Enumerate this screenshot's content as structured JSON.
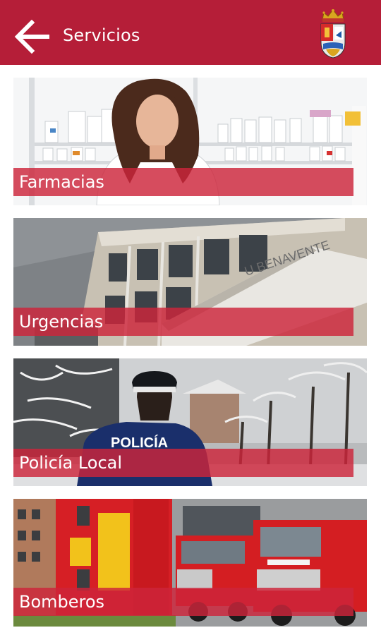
{
  "header": {
    "title": "Servicios",
    "back_icon": "arrow-left-icon",
    "crest_icon": "municipal-coat-of-arms",
    "background_color": "#b51e38"
  },
  "services": [
    {
      "label": "Farmacias"
    },
    {
      "label": "Urgencias"
    },
    {
      "label": "Policía Local",
      "uniform_text": "POLICÍA"
    },
    {
      "label": "Bomberos"
    }
  ],
  "colors": {
    "banner": "#cd243a",
    "accent": "#b51e38"
  }
}
